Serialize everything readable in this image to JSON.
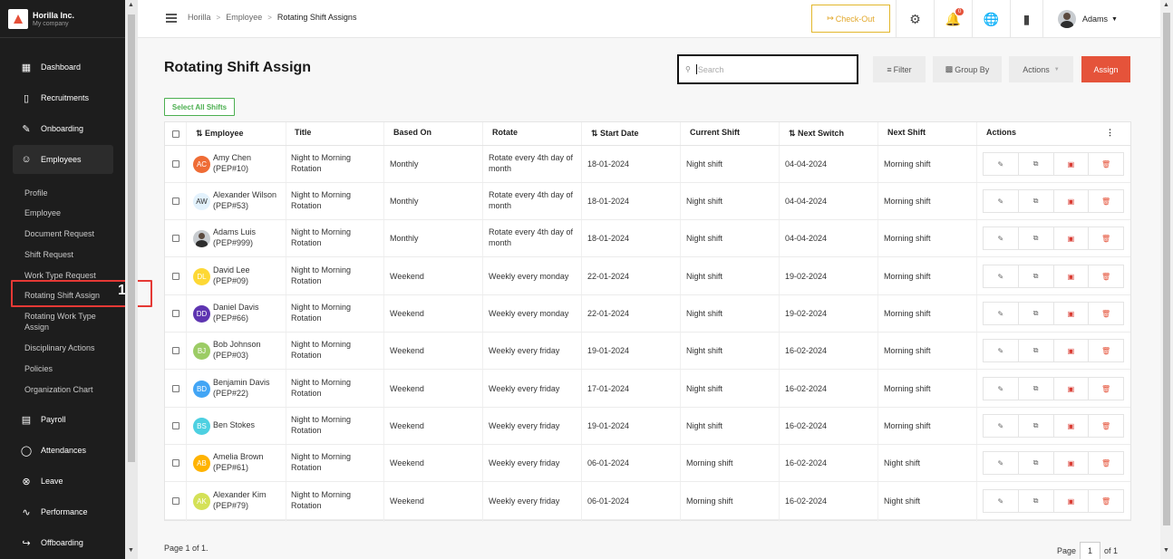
{
  "brand": {
    "name": "Horilla Inc.",
    "sub": "My company"
  },
  "nav": {
    "dashboard": "Dashboard",
    "recruitment": "Recruitments",
    "onboarding": "Onboarding",
    "employees": "Employees",
    "payroll": "Payroll",
    "attendances": "Attendances",
    "leave": "Leave",
    "performance": "Performance",
    "offboarding": "Offboarding"
  },
  "subnav": {
    "profile": "Profile",
    "employee": "Employee",
    "document_request": "Document Request",
    "shift_request": "Shift Request",
    "work_type_request": "Work Type Request",
    "rotating_shift_assign": "Rotating Shift Assign",
    "rotating_work_type_assign": "Rotating Work Type Assign",
    "disciplinary_actions": "Disciplinary Actions",
    "policies": "Policies",
    "organization_chart": "Organization Chart"
  },
  "annotation_badge": "1",
  "header": {
    "breadcrumb": [
      "Horilla",
      "Employee",
      "Rotating Shift Assigns"
    ],
    "sep": ">",
    "checkout": "Check-Out",
    "notification_count": "0",
    "user": "Adams"
  },
  "page": {
    "title": "Rotating Shift Assign",
    "search_placeholder": "Search",
    "filter": "Filter",
    "group_by": "Group By",
    "actions": "Actions",
    "assign": "Assign",
    "select_all": "Select All Shifts"
  },
  "table": {
    "headers": {
      "employee": "Employee",
      "title": "Title",
      "based_on": "Based On",
      "rotate": "Rotate",
      "start_date": "Start Date",
      "current_shift": "Current Shift",
      "next_switch": "Next Switch",
      "next_shift": "Next Shift",
      "actions": "Actions"
    },
    "rows": [
      {
        "initials": "AC",
        "color": "#ef6c35",
        "name": "Amy Chen",
        "id": "(PEP#10)",
        "title": "Night to Morning Rotation",
        "based_on": "Monthly",
        "rotate": "Rotate every 4th day of month",
        "start": "18-01-2024",
        "current": "Night shift",
        "next_switch": "04-04-2024",
        "next_shift": "Morning shift"
      },
      {
        "initials": "AW",
        "color": "#e3f2fd",
        "name": "Alexander Wilson",
        "id": "(PEP#53)",
        "title": "Night to Morning Rotation",
        "based_on": "Monthly",
        "rotate": "Rotate every 4th day of month",
        "start": "18-01-2024",
        "current": "Night shift",
        "next_switch": "04-04-2024",
        "next_shift": "Morning shift"
      },
      {
        "initials": "",
        "color": "photo",
        "name": "Adams Luis",
        "id": "(PEP#999)",
        "title": "Night to Morning Rotation",
        "based_on": "Monthly",
        "rotate": "Rotate every 4th day of month",
        "start": "18-01-2024",
        "current": "Night shift",
        "next_switch": "04-04-2024",
        "next_shift": "Morning shift"
      },
      {
        "initials": "DL",
        "color": "#fdd835",
        "name": "David Lee",
        "id": "(PEP#09)",
        "title": "Night to Morning Rotation",
        "based_on": "Weekend",
        "rotate": "Weekly every monday",
        "start": "22-01-2024",
        "current": "Night shift",
        "next_switch": "19-02-2024",
        "next_shift": "Morning shift"
      },
      {
        "initials": "DD",
        "color": "#5e35b1",
        "name": "Daniel Davis",
        "id": "(PEP#66)",
        "title": "Night to Morning Rotation",
        "based_on": "Weekend",
        "rotate": "Weekly every monday",
        "start": "22-01-2024",
        "current": "Night shift",
        "next_switch": "19-02-2024",
        "next_shift": "Morning shift"
      },
      {
        "initials": "BJ",
        "color": "#9ccc65",
        "name": "Bob Johnson",
        "id": "(PEP#03)",
        "title": "Night to Morning Rotation",
        "based_on": "Weekend",
        "rotate": "Weekly every friday",
        "start": "19-01-2024",
        "current": "Night shift",
        "next_switch": "16-02-2024",
        "next_shift": "Morning shift"
      },
      {
        "initials": "BD",
        "color": "#42a5f5",
        "name": "Benjamin Davis",
        "id": "(PEP#22)",
        "title": "Night to Morning Rotation",
        "based_on": "Weekend",
        "rotate": "Weekly every friday",
        "start": "17-01-2024",
        "current": "Night shift",
        "next_switch": "16-02-2024",
        "next_shift": "Morning shift"
      },
      {
        "initials": "BS",
        "color": "#4dd0e1",
        "name": "Ben Stokes",
        "id": "",
        "title": "Night to Morning Rotation",
        "based_on": "Weekend",
        "rotate": "Weekly every friday",
        "start": "19-01-2024",
        "current": "Night shift",
        "next_switch": "16-02-2024",
        "next_shift": "Morning shift"
      },
      {
        "initials": "AB",
        "color": "#ffb300",
        "name": "Amelia Brown",
        "id": "(PEP#61)",
        "title": "Night to Morning Rotation",
        "based_on": "Weekend",
        "rotate": "Weekly every friday",
        "start": "06-01-2024",
        "current": "Morning shift",
        "next_switch": "16-02-2024",
        "next_shift": "Night shift"
      },
      {
        "initials": "AK",
        "color": "#d4e157",
        "name": "Alexander Kim",
        "id": "(PEP#79)",
        "title": "Night to Morning Rotation",
        "based_on": "Weekend",
        "rotate": "Weekly every friday",
        "start": "06-01-2024",
        "current": "Morning shift",
        "next_switch": "16-02-2024",
        "next_shift": "Night shift"
      }
    ]
  },
  "pagination": {
    "summary": "Page 1 of 1.",
    "label": "Page",
    "current": "1",
    "of": "of 1"
  }
}
